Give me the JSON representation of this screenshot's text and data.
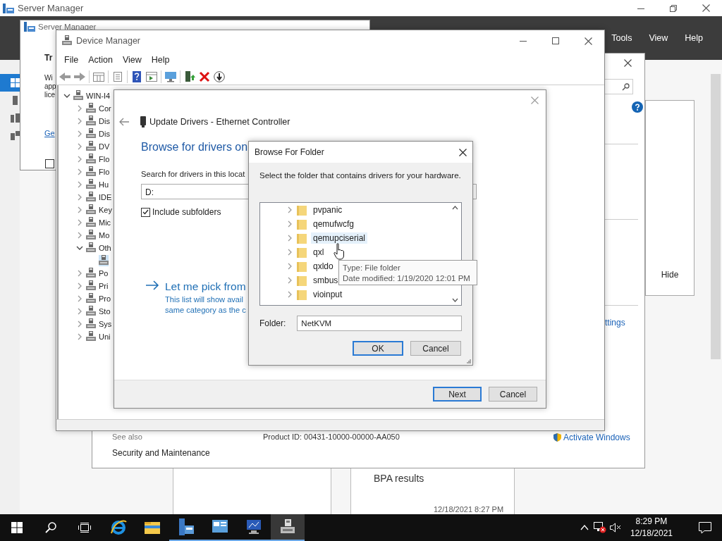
{
  "server_manager": {
    "title": "Server Manager",
    "menu": [
      {
        "label": "Tools"
      },
      {
        "label": "View"
      },
      {
        "label": "Help"
      }
    ],
    "nav": [
      {
        "selected": true
      },
      {
        "selected": false
      },
      {
        "selected": false
      },
      {
        "selected": false
      }
    ],
    "side_panel": {
      "button": "Hide"
    },
    "bpa_tile": {
      "title": "BPA results",
      "timestamp": "12/18/2021 8:27 PM"
    }
  },
  "welcome": {
    "title": "Server Manager",
    "heading": "Tr",
    "lines": [
      "Wi",
      "app",
      "lice"
    ],
    "link": "Ge",
    "checkbox": {
      "checked": false
    }
  },
  "system": {
    "link": "ttings",
    "see_also": "See also",
    "see_also_links": [
      "Security and Maintenance"
    ],
    "product_id": "Product ID: 00431-10000-00000-AA050",
    "activate": "Activate Windows"
  },
  "device_manager": {
    "title": "Device Manager",
    "menu": [
      "File",
      "Action",
      "View",
      "Help"
    ],
    "tree": [
      {
        "label": "WIN-I4",
        "expanded": true,
        "selected": false,
        "children": [
          {
            "label": "Cor",
            "expanded": false,
            "selected": false
          },
          {
            "label": "Dis",
            "expanded": false,
            "selected": false
          },
          {
            "label": "Dis",
            "expanded": false,
            "selected": false
          },
          {
            "label": "DV",
            "expanded": false,
            "selected": false
          },
          {
            "label": "Flo",
            "expanded": false,
            "selected": false
          },
          {
            "label": "Flo",
            "expanded": false,
            "selected": false
          },
          {
            "label": "Hu",
            "expanded": false,
            "selected": false
          },
          {
            "label": "IDE",
            "expanded": false,
            "selected": false
          },
          {
            "label": "Key",
            "expanded": false,
            "selected": false
          },
          {
            "label": "Mic",
            "expanded": false,
            "selected": false
          },
          {
            "label": "Mo",
            "expanded": false,
            "selected": false
          },
          {
            "label": "Oth",
            "expanded": true,
            "selected": false,
            "children": [
              {
                "selected": true
              }
            ]
          },
          {
            "label": "Po",
            "expanded": false,
            "selected": false
          },
          {
            "label": "Pri",
            "expanded": false,
            "selected": false
          },
          {
            "label": "Pro",
            "expanded": false,
            "selected": false
          },
          {
            "label": "Sto",
            "expanded": false,
            "selected": false
          },
          {
            "label": "Sys",
            "expanded": false,
            "selected": false
          },
          {
            "label": "Uni",
            "expanded": false,
            "selected": false
          }
        ]
      }
    ]
  },
  "update_drivers": {
    "title": "Update Drivers - Ethernet Controller",
    "heading": "Browse for drivers on",
    "search_label": "Search for drivers in this locat",
    "location": "D:",
    "include_subfolders": {
      "label": "Include subfolders",
      "checked": true
    },
    "pick": {
      "title": "Let me pick from",
      "lines": [
        "This list will show avail",
        "same category as the c"
      ]
    },
    "buttons": [
      {
        "label": "Next",
        "default": true
      },
      {
        "label": "Cancel",
        "default": false
      }
    ]
  },
  "browse_folder": {
    "title": "Browse For Folder",
    "prompt": "Select the folder that contains drivers for your hardware.",
    "folders": [
      {
        "name": "pvpanic",
        "hovered": false
      },
      {
        "name": "qemufwcfg",
        "hovered": false
      },
      {
        "name": "qemupciserial",
        "hovered": true
      },
      {
        "name": "qxl",
        "hovered": false
      },
      {
        "name": "qxldo",
        "hovered": false
      },
      {
        "name": "smbus",
        "hovered": false
      },
      {
        "name": "vioinput",
        "hovered": false
      }
    ],
    "folder_label": "Folder:",
    "folder_value": "NetKVM",
    "buttons": [
      {
        "label": "OK",
        "default": true
      },
      {
        "label": "Cancel",
        "default": false
      }
    ],
    "tooltip": [
      "Type: File folder",
      "Date modified: 1/19/2020 12:01 PM"
    ]
  },
  "taskbar": {
    "apps": [
      {
        "kind": "browser",
        "running": false,
        "active": false
      },
      {
        "kind": "folder",
        "running": false,
        "active": false
      },
      {
        "kind": "server",
        "running": true,
        "active": false
      },
      {
        "kind": "panel",
        "running": true,
        "active": false
      },
      {
        "kind": "monitor",
        "running": true,
        "active": false
      },
      {
        "kind": "device",
        "running": true,
        "active": true
      }
    ],
    "time": "8:29 PM",
    "date": "12/18/2021"
  }
}
